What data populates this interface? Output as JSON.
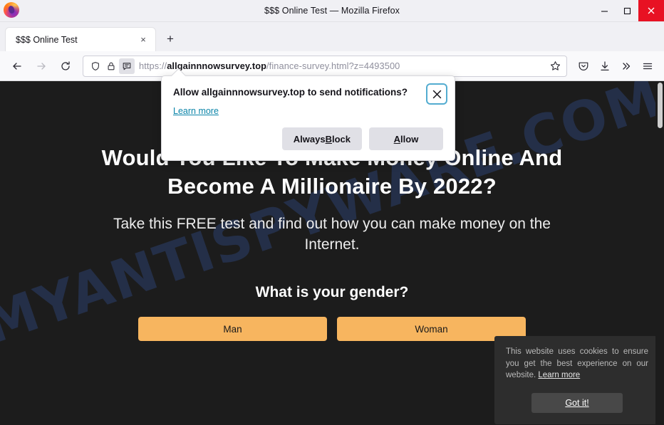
{
  "window": {
    "title": "$$$ Online Test — Mozilla Firefox",
    "minimize_label": "Minimize",
    "maximize_label": "Maximize",
    "close_label": "Close"
  },
  "tabs": {
    "items": [
      {
        "title": "$$$ Online Test",
        "close_label": "×"
      }
    ],
    "new_tab_label": "+"
  },
  "navbar": {
    "back_label": "Back",
    "forward_label": "Forward",
    "reload_label": "Reload",
    "url_scheme": "https://",
    "url_host": "allgainnnowsurvey.top",
    "url_path": "/finance-survey.html?z=4493500",
    "bookmark_label": "Bookmark this page",
    "pocket_label": "Save to Pocket",
    "downloads_label": "Downloads",
    "overflow_label": "More tools",
    "menu_label": "Open application menu"
  },
  "permission_popup": {
    "title": "Allow allgainnnowsurvey.top to send notifications?",
    "learn_more": "Learn more",
    "close_label": "×",
    "block_button_pre": "Always ",
    "block_button_accel": "B",
    "block_button_post": "lock",
    "allow_button_accel": "A",
    "allow_button_post": "llow"
  },
  "page": {
    "watermark": "MYANTISPYWARE.COM",
    "headline_line1": "Would You Like To Make Money Online And",
    "headline_line2": "Become A Millionaire By 2022?",
    "subhead": "Take this FREE test and find out how you can make money on the Internet.",
    "question": "What is your gender?",
    "answers": [
      {
        "label": "Man"
      },
      {
        "label": "Woman"
      }
    ],
    "accent_color": "#f7b55f",
    "background_color": "#1c1c1c"
  },
  "cookie_banner": {
    "text": "This website uses cookies to ensure you get the best experience on our website.",
    "learn_more": "Learn more",
    "accept_label": "Got it!"
  }
}
